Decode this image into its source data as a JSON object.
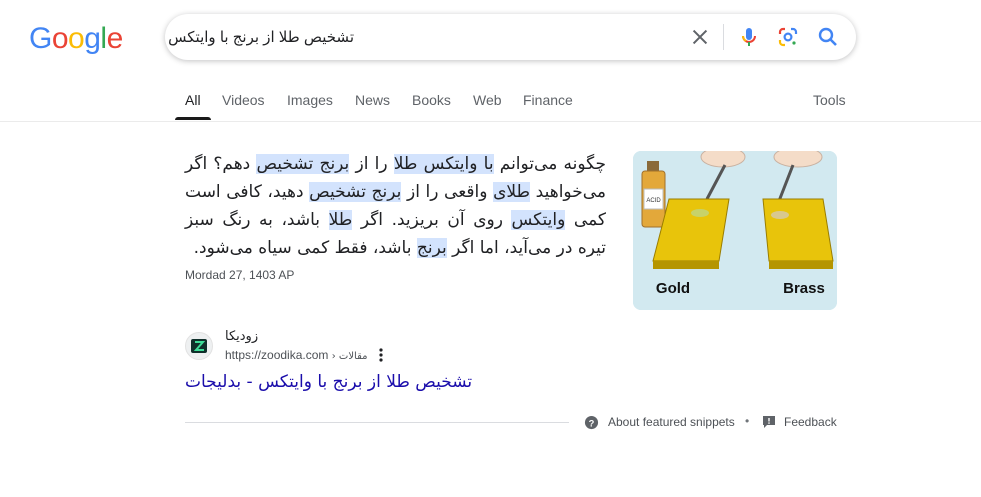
{
  "logo": {
    "text": "Google",
    "letters": [
      "G",
      "o",
      "o",
      "g",
      "l",
      "e"
    ],
    "colors": [
      "#4285F4",
      "#EA4335",
      "#FBBC05",
      "#4285F4",
      "#34A853",
      "#EA4335"
    ]
  },
  "search": {
    "query": "تشخیص طلا از برنج با وایتکس"
  },
  "tabs": [
    {
      "label": "All",
      "active": true
    },
    {
      "label": "Videos"
    },
    {
      "label": "Images"
    },
    {
      "label": "News"
    },
    {
      "label": "Books"
    },
    {
      "label": "Web"
    },
    {
      "label": "Finance"
    }
  ],
  "tools_label": "Tools",
  "snippet": {
    "segments": [
      {
        "text": "چگونه می‌توانم ",
        "hl": false
      },
      {
        "text": "با وایتکس طلا",
        "hl": true
      },
      {
        "text": " را از ",
        "hl": false
      },
      {
        "text": "برنج تشخیص",
        "hl": true
      },
      {
        "text": " دهم؟ اگر می‌خواهید ",
        "hl": false
      },
      {
        "text": "طلای",
        "hl": true
      },
      {
        "text": " واقعی را از ",
        "hl": false
      },
      {
        "text": "برنج تشخیص",
        "hl": true
      },
      {
        "text": " دهید، کافی است کمی ",
        "hl": false
      },
      {
        "text": "وایتکس",
        "hl": true
      },
      {
        "text": " روی آن بریزید. اگر ",
        "hl": false
      },
      {
        "text": "طلا",
        "hl": true
      },
      {
        "text": " باشد، به رنگ سبز تیره در می‌آید، اما اگر ",
        "hl": false
      },
      {
        "text": "برنج",
        "hl": true
      },
      {
        "text": " باشد، فقط کمی سیاه می‌شود.",
        "hl": false
      }
    ],
    "date": "Mordad 27, 1403 AP",
    "image": {
      "label_left": "Gold",
      "label_right": "Brass",
      "bottle_label": "ACID"
    }
  },
  "source": {
    "site_name": "زودیکا",
    "url": "https://zoodika.com",
    "breadcrumb": "› مقالات",
    "title": "تشخیص طلا از برنج با وایتکس - بدلیجات"
  },
  "footer": {
    "about_label": "About featured snippets",
    "separator": "•",
    "feedback_label": "Feedback"
  },
  "icons": {
    "clear": "close-icon",
    "mic": "microphone-icon",
    "lens": "google-lens-icon",
    "search": "search-icon",
    "about": "help-circle-icon",
    "feedback": "feedback-icon",
    "more": "more-vert-icon"
  }
}
